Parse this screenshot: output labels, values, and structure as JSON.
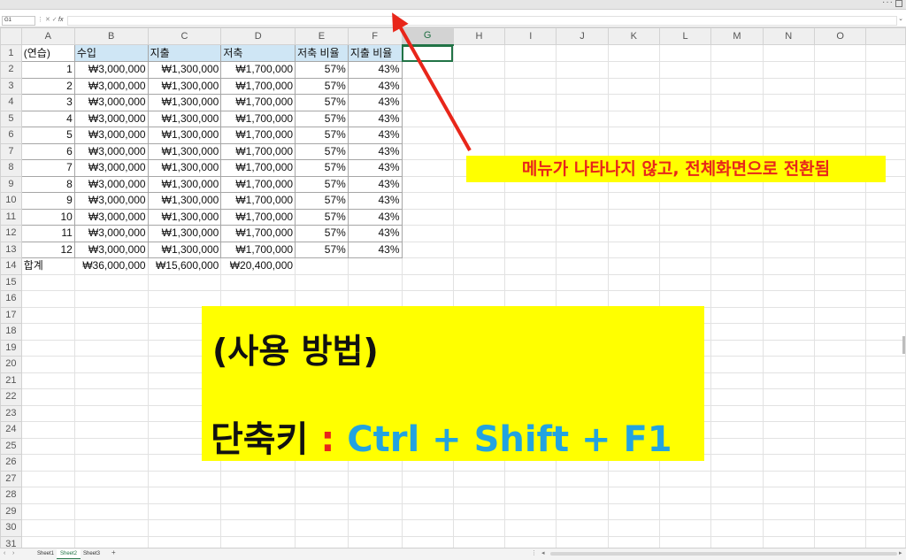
{
  "formula_bar": {
    "name_box": "G1",
    "fx": "fx"
  },
  "columns": [
    "A",
    "B",
    "C",
    "D",
    "E",
    "F",
    "G",
    "H",
    "I",
    "J",
    "K",
    "L",
    "M",
    "N",
    "O"
  ],
  "header_row": {
    "a": "(연습)",
    "b": "수입",
    "c": "지출",
    "d": "저축",
    "e": "저축 비율",
    "f": "지출 비율"
  },
  "data_rows": [
    {
      "n": "1",
      "income": "₩3,000,000",
      "expense": "₩1,300,000",
      "saving": "₩1,700,000",
      "save_ratio": "57%",
      "spend_ratio": "43%"
    },
    {
      "n": "2",
      "income": "₩3,000,000",
      "expense": "₩1,300,000",
      "saving": "₩1,700,000",
      "save_ratio": "57%",
      "spend_ratio": "43%"
    },
    {
      "n": "3",
      "income": "₩3,000,000",
      "expense": "₩1,300,000",
      "saving": "₩1,700,000",
      "save_ratio": "57%",
      "spend_ratio": "43%"
    },
    {
      "n": "4",
      "income": "₩3,000,000",
      "expense": "₩1,300,000",
      "saving": "₩1,700,000",
      "save_ratio": "57%",
      "spend_ratio": "43%"
    },
    {
      "n": "5",
      "income": "₩3,000,000",
      "expense": "₩1,300,000",
      "saving": "₩1,700,000",
      "save_ratio": "57%",
      "spend_ratio": "43%"
    },
    {
      "n": "6",
      "income": "₩3,000,000",
      "expense": "₩1,300,000",
      "saving": "₩1,700,000",
      "save_ratio": "57%",
      "spend_ratio": "43%"
    },
    {
      "n": "7",
      "income": "₩3,000,000",
      "expense": "₩1,300,000",
      "saving": "₩1,700,000",
      "save_ratio": "57%",
      "spend_ratio": "43%"
    },
    {
      "n": "8",
      "income": "₩3,000,000",
      "expense": "₩1,300,000",
      "saving": "₩1,700,000",
      "save_ratio": "57%",
      "spend_ratio": "43%"
    },
    {
      "n": "9",
      "income": "₩3,000,000",
      "expense": "₩1,300,000",
      "saving": "₩1,700,000",
      "save_ratio": "57%",
      "spend_ratio": "43%"
    },
    {
      "n": "10",
      "income": "₩3,000,000",
      "expense": "₩1,300,000",
      "saving": "₩1,700,000",
      "save_ratio": "57%",
      "spend_ratio": "43%"
    },
    {
      "n": "11",
      "income": "₩3,000,000",
      "expense": "₩1,300,000",
      "saving": "₩1,700,000",
      "save_ratio": "57%",
      "spend_ratio": "43%"
    },
    {
      "n": "12",
      "income": "₩3,000,000",
      "expense": "₩1,300,000",
      "saving": "₩1,700,000",
      "save_ratio": "57%",
      "spend_ratio": "43%"
    }
  ],
  "total_row": {
    "label": "합계",
    "income": "₩36,000,000",
    "expense": "₩15,600,000",
    "saving": "₩20,400,000"
  },
  "row_count": 31,
  "sheet_tabs": [
    "Sheet1",
    "Sheet2",
    "Sheet3"
  ],
  "active_sheet": "Sheet2",
  "add_sheet": "+",
  "annotation": "메뉴가 나타나지 않고, 전체화면으로 전환됨",
  "howto": {
    "title": "(사용 방법)",
    "shortcut_label": "단축키",
    "colon": ":",
    "keys": "Ctrl + Shift + F1"
  },
  "colors": {
    "header_fill": "#cfe6f5",
    "callout_fill": "#ffff00",
    "annotation_text": "#e8261a",
    "keys_text": "#22a3e0",
    "selection": "#217346"
  }
}
